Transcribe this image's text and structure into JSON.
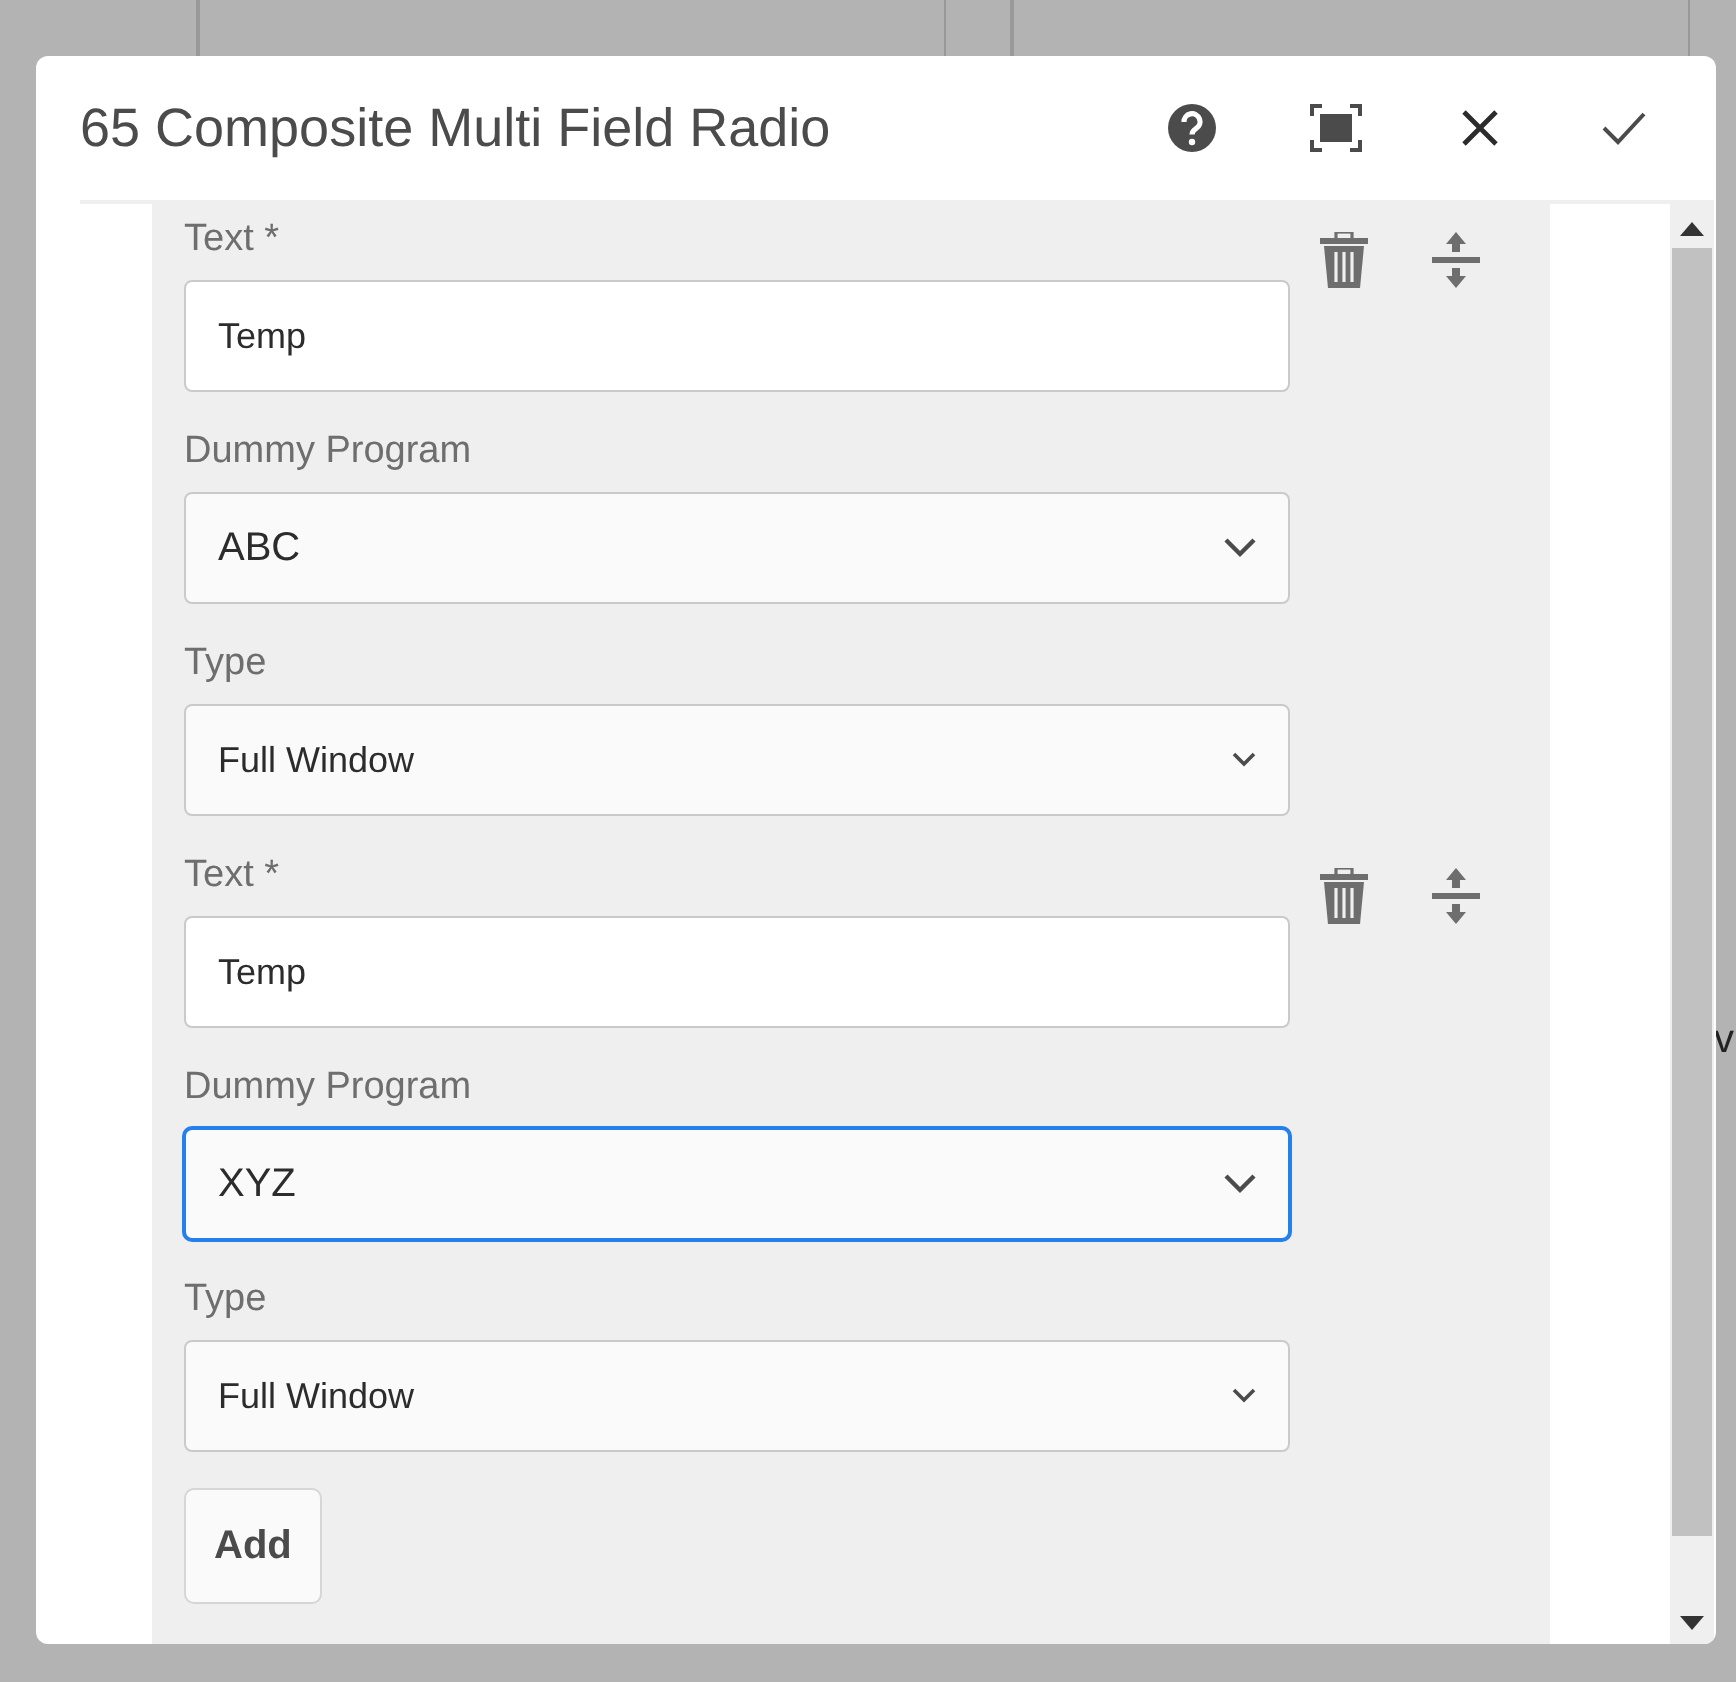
{
  "background": {
    "fragment": "v"
  },
  "dialog": {
    "title": "65 Composite Multi Field Radio",
    "items": [
      {
        "text_label": "Text *",
        "text_value": "Temp",
        "program_label": "Dummy Program",
        "program_value": "ABC",
        "program_focused": false,
        "type_label": "Type",
        "type_value": "Full Window"
      },
      {
        "text_label": "Text *",
        "text_value": "Temp",
        "program_label": "Dummy Program",
        "program_value": "XYZ",
        "program_focused": true,
        "type_label": "Type",
        "type_value": "Full Window"
      }
    ],
    "add_button": "Add"
  }
}
